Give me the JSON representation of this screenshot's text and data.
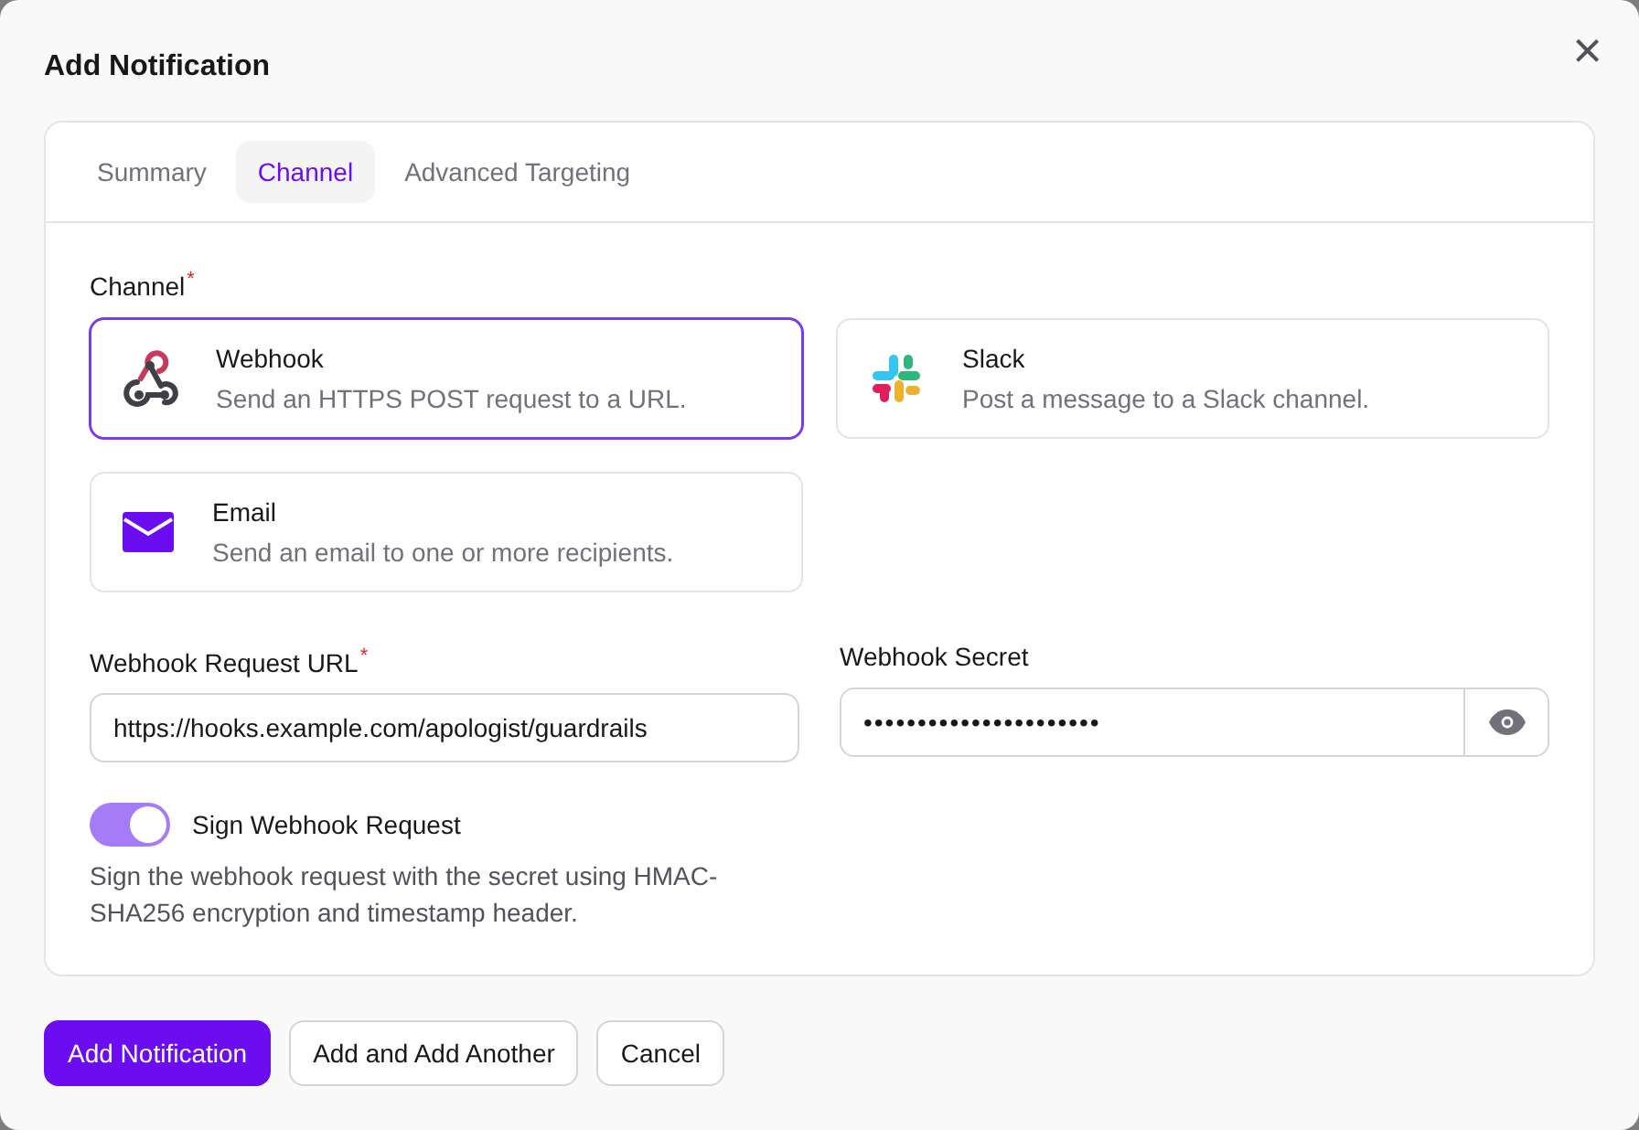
{
  "dialog": {
    "title": "Add Notification",
    "close": "×"
  },
  "tabs": [
    {
      "label": "Summary",
      "selected": false
    },
    {
      "label": "Channel",
      "selected": true
    },
    {
      "label": "Advanced Targeting",
      "selected": false
    }
  ],
  "channel_field": {
    "label": "Channel",
    "required_mark": "*"
  },
  "channels": [
    {
      "kind": "webhook",
      "name": "Webhook",
      "description": "Send an HTTPS POST request to a URL.",
      "selected": true
    },
    {
      "kind": "slack",
      "name": "Slack",
      "description": "Post a message to a Slack channel.",
      "selected": false
    },
    {
      "kind": "email",
      "name": "Email",
      "description": "Send an email to one or more recipients.",
      "selected": false
    }
  ],
  "url_field": {
    "label": "Webhook Request URL",
    "required_mark": "*",
    "value": "https://hooks.example.com/apologist/guardrails"
  },
  "secret_field": {
    "label": "Webhook Secret",
    "value": "••••••••••••••••••••••"
  },
  "sign_toggle": {
    "label": "Sign Webhook Request",
    "on": true,
    "help": "Sign the webhook request with the secret using HMAC-SHA256 encryption and timestamp header."
  },
  "buttons": [
    {
      "label": "Add Notification",
      "kind": "primary"
    },
    {
      "label": "Add and Add Another",
      "kind": "secondary"
    },
    {
      "label": "Cancel",
      "kind": "secondary"
    }
  ]
}
